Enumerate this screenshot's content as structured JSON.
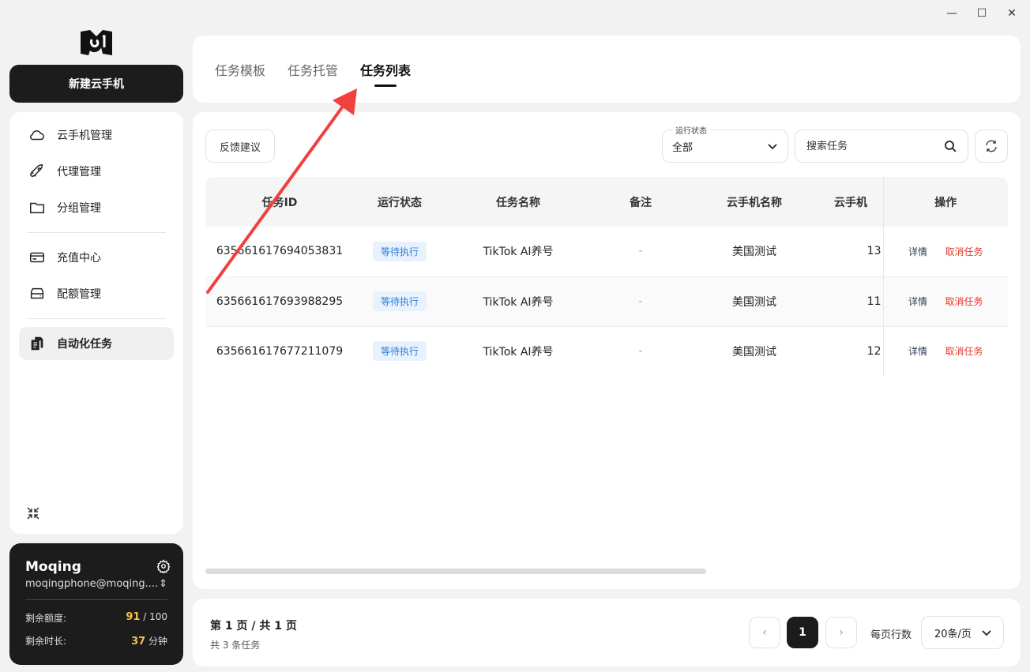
{
  "window_controls": {
    "minimize": "—",
    "maximize": "☐",
    "close": "✕"
  },
  "sidebar": {
    "new_button": "新建云手机",
    "items": [
      {
        "label": "云手机管理",
        "icon": "cloud-icon"
      },
      {
        "label": "代理管理",
        "icon": "rocket-icon"
      },
      {
        "label": "分组管理",
        "icon": "folder-icon"
      },
      {
        "label": "充值中心",
        "icon": "card-icon"
      },
      {
        "label": "配额管理",
        "icon": "storage-icon"
      },
      {
        "label": "自动化任务",
        "icon": "clipboard-icon",
        "active": true
      }
    ]
  },
  "account": {
    "name": "Moqing",
    "email": "moqingphone@moqing....",
    "quota_label": "剩余额度:",
    "quota_used": "91",
    "quota_total": "/ 100",
    "time_label": "剩余时长:",
    "time_value": "37",
    "time_unit": "分钟"
  },
  "tabs": [
    {
      "label": "任务模板"
    },
    {
      "label": "任务托管"
    },
    {
      "label": "任务列表",
      "active": true
    }
  ],
  "toolbar": {
    "feedback": "反馈建议",
    "status_label": "运行状态",
    "status_value": "全部",
    "search_placeholder": "搜索任务"
  },
  "table": {
    "headers": [
      "任务ID",
      "运行状态",
      "任务名称",
      "备注",
      "云手机名称",
      "云手机",
      "操作"
    ],
    "rows": [
      {
        "id": "635661617694053831",
        "status": "等待执行",
        "name": "TikTok AI养号",
        "remark": "-",
        "phone": "美国测试",
        "phone_id": "13",
        "detail": "详情",
        "cancel": "取消任务"
      },
      {
        "id": "635661617693988295",
        "status": "等待执行",
        "name": "TikTok AI养号",
        "remark": "-",
        "phone": "美国测试",
        "phone_id": "11",
        "detail": "详情",
        "cancel": "取消任务"
      },
      {
        "id": "635661617677211079",
        "status": "等待执行",
        "name": "TikTok AI养号",
        "remark": "-",
        "phone": "美国测试",
        "phone_id": "12",
        "detail": "详情",
        "cancel": "取消任务"
      }
    ]
  },
  "pagination": {
    "page_text": "第 1 页 / 共 1 页",
    "total_text": "共 3 条任务",
    "prev": "‹",
    "current": "1",
    "next": "›",
    "per_page_label": "每页行数",
    "per_page_value": "20条/页"
  },
  "colors": {
    "accent": "#1c1c1c",
    "badge_text": "#2b7de0",
    "cancel": "#e03a2f",
    "annotation_arrow": "#f04040",
    "quota": "#f5c24a"
  }
}
